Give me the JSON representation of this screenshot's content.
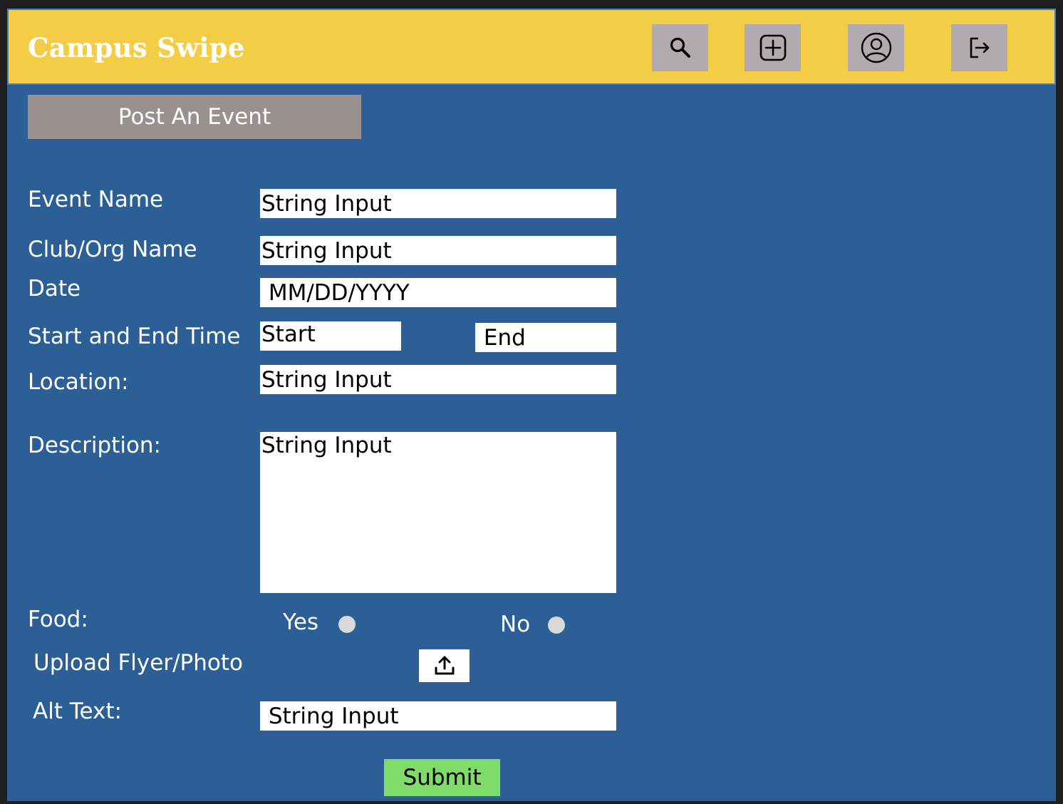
{
  "app": {
    "title": "Campus Swipe"
  },
  "header": {
    "buttons": [
      {
        "name": "search",
        "icon": "search-icon"
      },
      {
        "name": "add",
        "icon": "plus-square-icon"
      },
      {
        "name": "profile",
        "icon": "user-circle-icon"
      },
      {
        "name": "logout",
        "icon": "logout-icon"
      }
    ]
  },
  "page": {
    "title": "Post An Event"
  },
  "form": {
    "event_name": {
      "label": "Event Name",
      "placeholder": "String Input",
      "value": ""
    },
    "club_name": {
      "label": "Club/Org Name",
      "placeholder": "String Input",
      "value": ""
    },
    "date": {
      "label": "Date",
      "placeholder": " MM/DD/YYYY",
      "value": ""
    },
    "time": {
      "label": "Start and End Time",
      "start_placeholder": "Start",
      "end_placeholder": " End"
    },
    "location": {
      "label": "Location:",
      "placeholder": "String Input",
      "value": ""
    },
    "description": {
      "label": "Description:",
      "placeholder": "String Input",
      "value": ""
    },
    "food": {
      "label": "Food:",
      "yes_label": "Yes",
      "no_label": "No"
    },
    "upload": {
      "label": "Upload Flyer/Photo",
      "icon": "upload-icon"
    },
    "alt_text": {
      "label": "Alt Text:",
      "placeholder": " String Input",
      "value": ""
    },
    "submit_label": "Submit"
  },
  "colors": {
    "header_bg": "#f4cd47",
    "page_bg": "#2c5f95",
    "icon_button_bg": "#b1aab1",
    "title_button_bg": "#9a918f",
    "submit_bg": "#7fdc6a",
    "radio_dot": "#d9d9d9"
  }
}
